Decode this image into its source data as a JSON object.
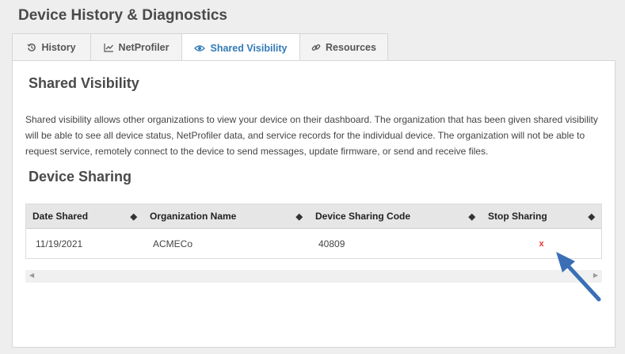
{
  "page": {
    "title": "Device History & Diagnostics"
  },
  "tabs": [
    {
      "label": "History",
      "icon": "history-icon"
    },
    {
      "label": "NetProfiler",
      "icon": "line-chart-icon"
    },
    {
      "label": "Shared Visibility",
      "icon": "eye-icon",
      "active": true
    },
    {
      "label": "Resources",
      "icon": "link-icon"
    }
  ],
  "shared": {
    "title": "Shared Visibility",
    "description": "Shared visibility allows other organizations to view your device on their dashboard. The organization that has been given shared visibility will be able to see all device status, NetProfiler data, and service records for the individual device. The organization will not be able to request service, remotely connect to the device to send messages, update firmware, or send and receive files."
  },
  "sharing": {
    "title": "Device Sharing",
    "columns": [
      "Date Shared",
      "Organization Name",
      "Device Sharing Code",
      "Stop Sharing"
    ],
    "rows": [
      {
        "date": "11/19/2021",
        "org": "ACMECo",
        "code": "40809",
        "stop": "x"
      }
    ]
  },
  "colors": {
    "accent": "#337ab7",
    "stop": "#e53935",
    "arrow": "#3a6fb5"
  }
}
